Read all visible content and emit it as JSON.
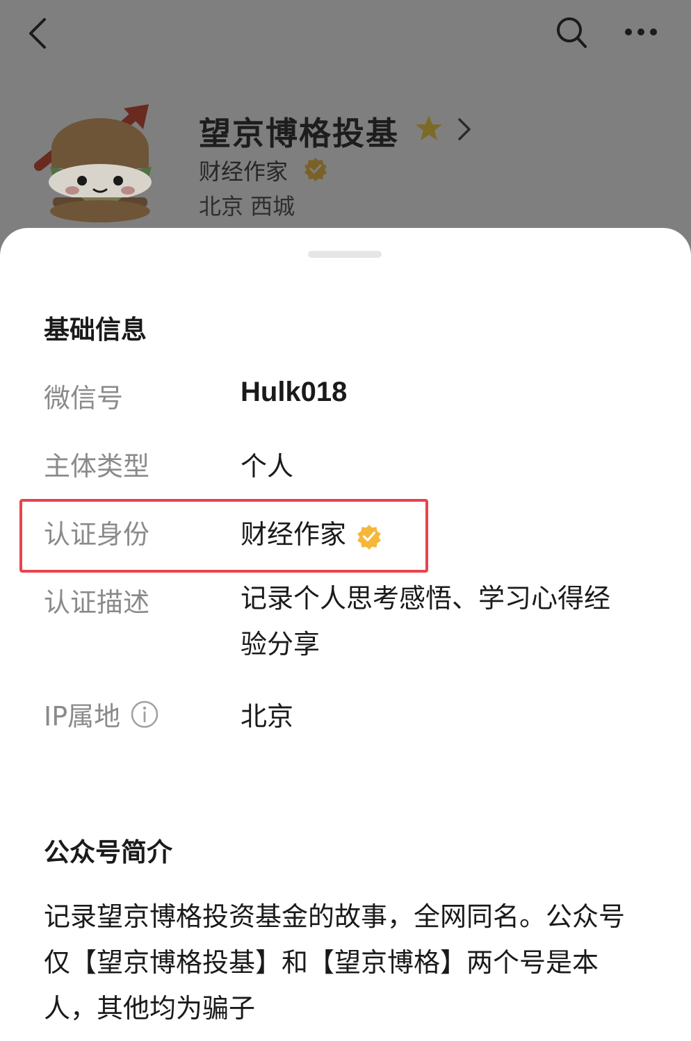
{
  "header": {
    "icons": [
      "back-arrow-icon",
      "search-icon",
      "more-icon"
    ]
  },
  "profile": {
    "name": "望京博格投基",
    "role": "财经作家",
    "location": "北京 西城"
  },
  "basic_info": {
    "title": "基础信息",
    "rows": [
      {
        "label": "微信号",
        "value": "Hulk018"
      },
      {
        "label": "主体类型",
        "value": "个人"
      },
      {
        "label": "认证身份",
        "value": "财经作家"
      },
      {
        "label": "认证描述",
        "value": "记录个人思考感悟、学习心得经验分享"
      },
      {
        "label": "IP属地",
        "value": "北京"
      }
    ]
  },
  "intro": {
    "title": "公众号简介",
    "text": "记录望京博格投资基金的故事，全网同名。公众号仅【望京博格投基】和【望京博格】两个号是本人，其他均为骗子"
  },
  "colors": {
    "overlay": "#7f7f7f",
    "highlight": "#e8434c",
    "badge": "#f5b73b",
    "star": "#e0a82a"
  }
}
